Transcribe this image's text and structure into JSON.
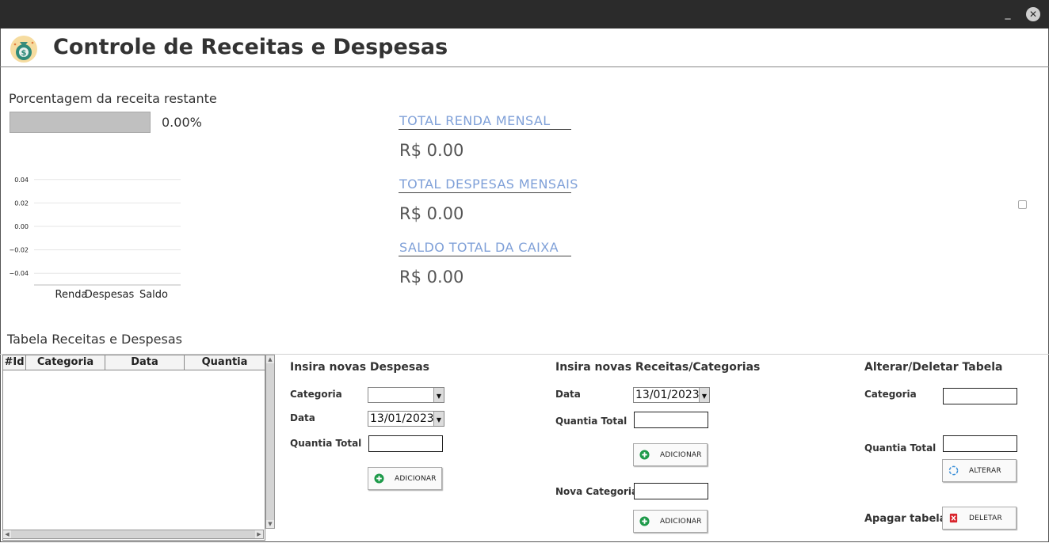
{
  "window": {
    "minimize_glyph": "_",
    "close_glyph": "✕"
  },
  "header": {
    "title": "Controle de Receitas e Despesas",
    "logo_icon": "money-bag-icon"
  },
  "percent": {
    "label": "Porcentagem da receita restante",
    "value_text": "0.00%",
    "fraction": 0.0
  },
  "chart_data": {
    "type": "bar",
    "categories": [
      "Renda",
      "Despesas",
      "Saldo"
    ],
    "values": [
      0,
      0,
      0
    ],
    "yticks": [
      "0.04",
      "0.02",
      "0.00",
      "−0.02",
      "−0.04"
    ],
    "ylim": [
      -0.05,
      0.05
    ],
    "grid": true
  },
  "totals": [
    {
      "label": "TOTAL RENDA MENSAL",
      "value": "R$ 0.00"
    },
    {
      "label": "TOTAL DESPESAS MENSAIS",
      "value": "R$ 0.00"
    },
    {
      "label": "SALDO TOTAL DA CAIXA",
      "value": "R$ 0.00"
    }
  ],
  "table": {
    "label": "Tabela Receitas e Despesas",
    "columns": [
      "#Id",
      "Categoria",
      "Data",
      "Quantia"
    ],
    "rows": []
  },
  "despesas": {
    "title": "Insira novas Despesas",
    "categoria_label": "Categoria",
    "categoria_value": "",
    "data_label": "Data",
    "data_value": "13/01/2023",
    "quantia_label": "Quantia Total",
    "button": "ADICIONAR"
  },
  "receitas": {
    "title": "Insira novas Receitas/Categorias",
    "data_label": "Data",
    "data_value": "13/01/2023",
    "quantia_label": "Quantia Total",
    "button": "ADICIONAR",
    "categoria_label": "Nova Categoria",
    "categoria_button": "ADICIONAR"
  },
  "alterar": {
    "title": "Alterar/Deletar Tabela",
    "categoria_label": "Categoria",
    "quantia_label": "Quantia Total",
    "alterar_button": "ALTERAR",
    "apagar_label": "Apagar tabela",
    "deletar_button": "DELETAR"
  },
  "colors": {
    "accent_label": "#7fa0d8",
    "add_icon": "#1e9a4a",
    "refresh_icon": "#3a8fd8",
    "delete_icon": "#d9252d"
  }
}
